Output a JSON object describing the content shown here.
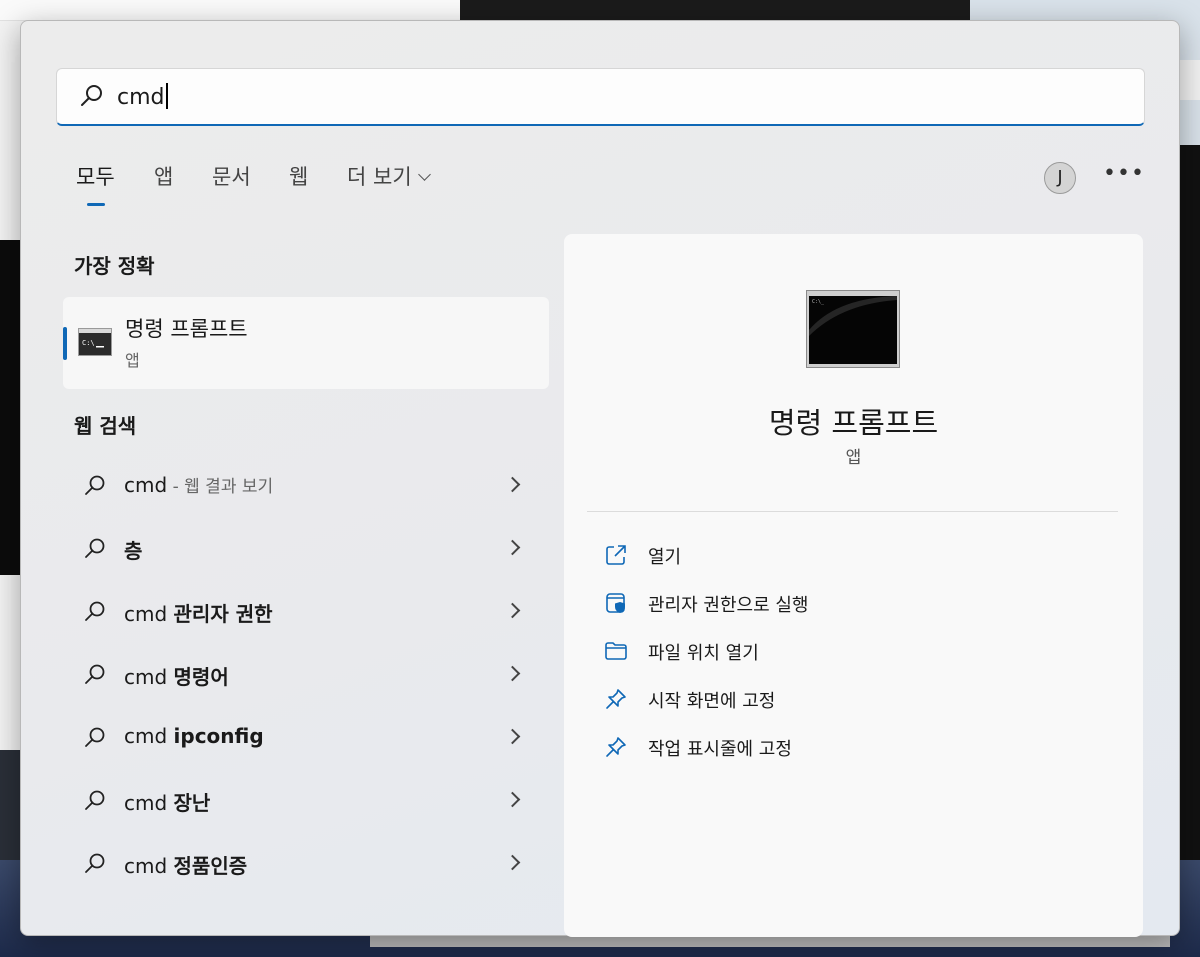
{
  "search": {
    "query": "cmd"
  },
  "tabs": [
    {
      "label": "모두"
    },
    {
      "label": "앱"
    },
    {
      "label": "문서"
    },
    {
      "label": "웹"
    },
    {
      "label": "더 보기"
    }
  ],
  "user": {
    "initial": "J"
  },
  "more_label": "•••",
  "best_match": {
    "title": "가장 정확",
    "name": "명령 프롬프트",
    "type": "앱"
  },
  "web_search": {
    "title": "웹 검색",
    "rows": [
      {
        "prefix": "cmd",
        "bold": "",
        "sub": " - 웹 결과 보기"
      },
      {
        "prefix": "",
        "bold": "층",
        "sub": ""
      },
      {
        "prefix": "cmd ",
        "bold": "관리자 권한",
        "sub": ""
      },
      {
        "prefix": "cmd ",
        "bold": "명령어",
        "sub": ""
      },
      {
        "prefix": "cmd ",
        "bold": "ipconfig",
        "sub": ""
      },
      {
        "prefix": "cmd ",
        "bold": "장난",
        "sub": ""
      },
      {
        "prefix": "cmd ",
        "bold": "정품인증",
        "sub": ""
      }
    ]
  },
  "detail": {
    "name": "명령 프롬프트",
    "type": "앱",
    "actions": [
      {
        "label": "열기",
        "icon": "open-external-icon"
      },
      {
        "label": "관리자 권한으로 실행",
        "icon": "admin-shield-icon"
      },
      {
        "label": "파일 위치 열기",
        "icon": "folder-icon"
      },
      {
        "label": "시작 화면에 고정",
        "icon": "pin-icon"
      },
      {
        "label": "작업 표시줄에 고정",
        "icon": "pin-icon"
      }
    ]
  },
  "colors": {
    "accent": "#0f68b6"
  }
}
